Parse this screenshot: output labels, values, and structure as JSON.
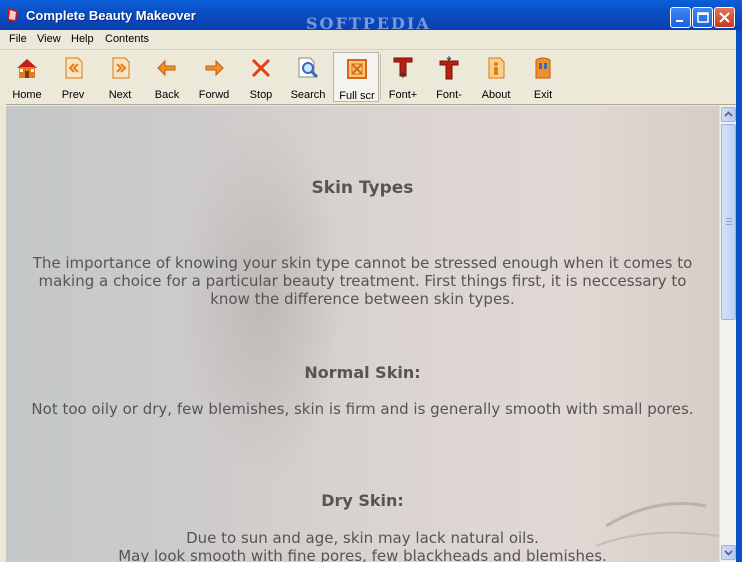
{
  "window": {
    "title": "Complete Beauty Makeover",
    "watermark": "SOFTPEDIA"
  },
  "menu": [
    "File",
    "View",
    "Help",
    "Contents"
  ],
  "toolbar": [
    {
      "label": "Home",
      "icon": "house-icon"
    },
    {
      "label": "Prev",
      "icon": "double-left-page-icon"
    },
    {
      "label": "Next",
      "icon": "double-right-page-icon"
    },
    {
      "label": "Back",
      "icon": "arrow-left-icon"
    },
    {
      "label": "Forwd",
      "icon": "arrow-right-icon"
    },
    {
      "label": "Stop",
      "icon": "x-stop-icon"
    },
    {
      "label": "Search",
      "icon": "magnifier-document-icon"
    },
    {
      "label": "Full scr",
      "icon": "fullscreen-icon"
    },
    {
      "label": "Font+",
      "icon": "font-increase-icon"
    },
    {
      "label": "Font-",
      "icon": "font-decrease-icon"
    },
    {
      "label": "About",
      "icon": "info-document-icon"
    },
    {
      "label": "Exit",
      "icon": "exit-door-icon"
    }
  ],
  "content": {
    "heading": "Skin Types",
    "intro": "The importance of knowing your skin type cannot be stressed enough when it comes to making a choice for a particular beauty treatment. First things first, it is neccessary to know the difference between skin types.",
    "normal_heading": "Normal Skin:",
    "normal_text": "Not too oily or dry, few blemishes, skin is firm and is generally smooth with small pores.",
    "dry_heading": "Dry Skin:",
    "dry_text_1": "Due to sun and age, skin may lack natural oils.",
    "dry_text_2": "May look smooth with fine pores, few blackheads and blemishes."
  },
  "colors": {
    "titlebar": "#0a4fc4",
    "icon_orange": "#e87a18",
    "icon_red": "#c4201a",
    "text": "#555555"
  }
}
